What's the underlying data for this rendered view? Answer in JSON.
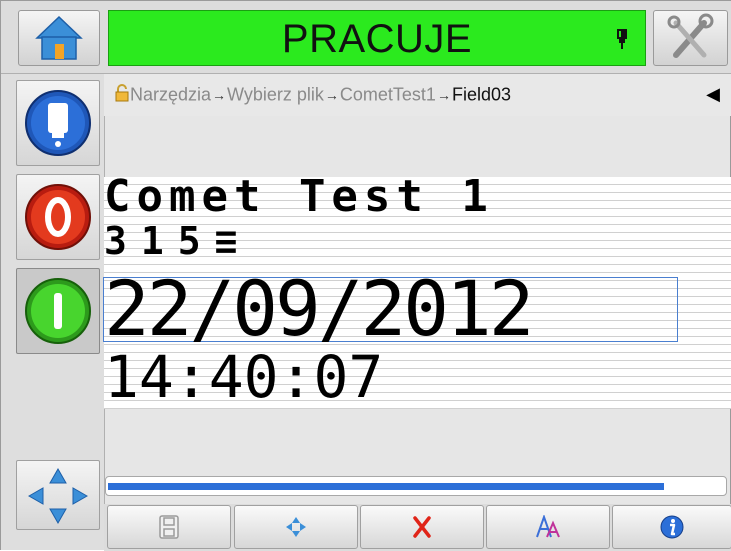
{
  "status": {
    "text": "PRACUJE",
    "color": "#2bea1e"
  },
  "breadcrumb": {
    "items": [
      "Narzędzia",
      "Wybierz plik",
      "CometTest1",
      "Field03"
    ],
    "separator": "→",
    "back_icon": "◀"
  },
  "message": {
    "line1": "Comet Test 1",
    "line2": "315≡",
    "line3": "22/09/2012",
    "line4": "14:40:07"
  },
  "progress": {
    "value": 0.9
  },
  "icons": {
    "home": "home-icon",
    "status": "printhead-icon",
    "tools": "tools-icon",
    "side1": "ink-bottle-icon",
    "side2": "stop-icon",
    "side3": "start-icon",
    "side4": "navigate-icon",
    "tb1": "save-icon",
    "tb2": "move-icon",
    "tb3": "delete-icon",
    "tb4": "font-icon",
    "tb5": "info-icon"
  }
}
